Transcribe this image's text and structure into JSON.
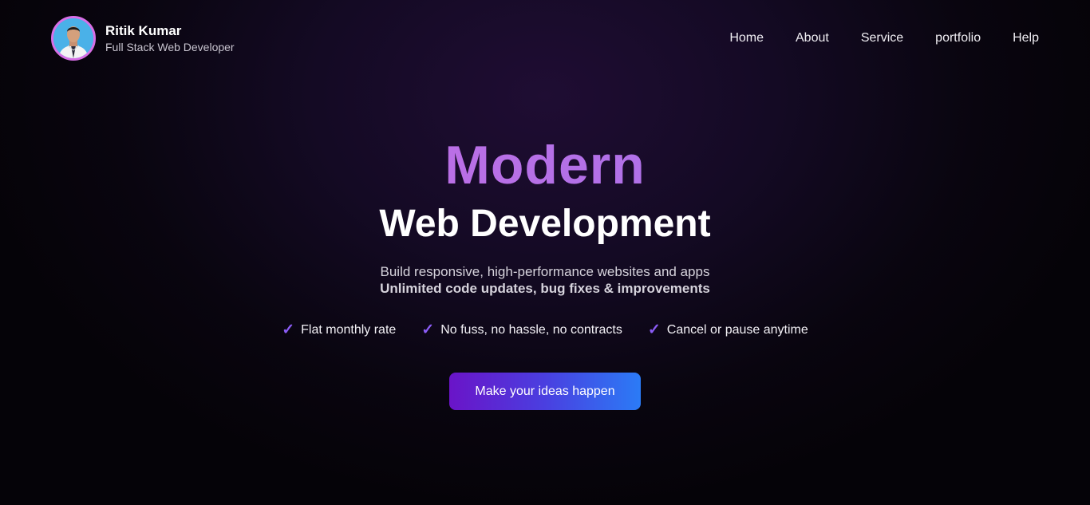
{
  "brand": {
    "name": "Ritik Kumar",
    "role": "Full Stack Web Developer",
    "avatar_icon": "profile-photo"
  },
  "nav": {
    "items": [
      {
        "label": "Home"
      },
      {
        "label": "About"
      },
      {
        "label": "Service"
      },
      {
        "label": "portfolio"
      },
      {
        "label": "Help"
      }
    ]
  },
  "hero": {
    "accent": "Modern",
    "title": "Web Development",
    "subtitle": "Build responsive, high-performance websites and apps",
    "subtitle_bold": "Unlimited code updates, bug fixes & improvements",
    "features": [
      {
        "icon": "check-icon",
        "label": "Flat monthly rate"
      },
      {
        "icon": "check-icon",
        "label": "No fuss, no hassle, no contracts"
      },
      {
        "icon": "check-icon",
        "label": "Cancel or pause anytime"
      }
    ],
    "cta_label": "Make your ideas happen"
  },
  "colors": {
    "accent_pink": "#d06ae0",
    "accent_purple": "#9a78ea",
    "check": "#8b5cf6",
    "cta_start": "#6a14c8",
    "cta_end": "#2b7bf6",
    "background": "#0b0612"
  }
}
